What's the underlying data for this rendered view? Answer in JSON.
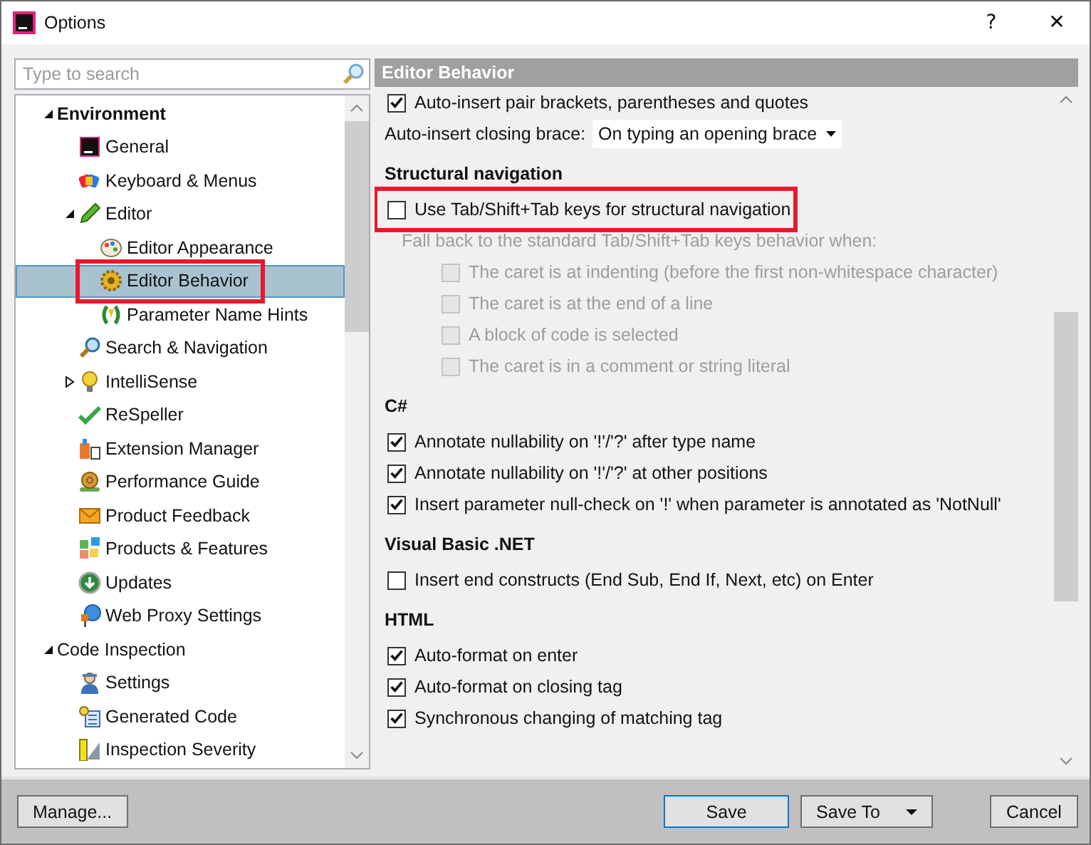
{
  "window": {
    "title": "Options",
    "help": "?",
    "close": "✕"
  },
  "search": {
    "placeholder": "Type to search"
  },
  "tree": [
    {
      "label": "Environment",
      "expanded": true,
      "selected": false,
      "highlighted": false,
      "children": [
        {
          "label": "General",
          "selected": false,
          "highlighted": false
        },
        {
          "label": "Keyboard & Menus",
          "selected": false,
          "highlighted": false
        },
        {
          "label": "Editor",
          "expanded": true,
          "selected": false,
          "highlighted": false,
          "children": [
            {
              "label": "Editor Appearance",
              "selected": false,
              "highlighted": false
            },
            {
              "label": "Editor Behavior",
              "selected": true,
              "highlighted": true
            },
            {
              "label": "Parameter Name Hints",
              "selected": false,
              "highlighted": false
            }
          ]
        },
        {
          "label": "Search & Navigation",
          "selected": false,
          "highlighted": false
        },
        {
          "label": "IntelliSense",
          "expanded": false,
          "selected": false,
          "highlighted": false
        },
        {
          "label": "ReSpeller",
          "selected": false,
          "highlighted": false
        },
        {
          "label": "Extension Manager",
          "selected": false,
          "highlighted": false
        },
        {
          "label": "Performance Guide",
          "selected": false,
          "highlighted": false
        },
        {
          "label": "Product Feedback",
          "selected": false,
          "highlighted": false
        },
        {
          "label": "Products & Features",
          "selected": false,
          "highlighted": false
        },
        {
          "label": "Updates",
          "selected": false,
          "highlighted": false
        },
        {
          "label": "Web Proxy Settings",
          "selected": false,
          "highlighted": false
        }
      ]
    },
    {
      "label": "Code Inspection",
      "expanded": true,
      "selected": false,
      "highlighted": false,
      "children": [
        {
          "label": "Settings",
          "selected": false,
          "highlighted": false
        },
        {
          "label": "Generated Code",
          "selected": false,
          "highlighted": false
        },
        {
          "label": "Inspection Severity",
          "selected": false,
          "highlighted": false
        }
      ]
    }
  ],
  "page": {
    "title": "Editor Behavior",
    "rows": [
      {
        "kind": "checkbox",
        "label": "Auto-insert pair brackets, parentheses and quotes",
        "checked": true,
        "disabled": false,
        "highlighted": false
      },
      {
        "kind": "dropdown",
        "label": "Auto-insert closing brace:",
        "value": "On typing an opening brace"
      },
      {
        "kind": "heading",
        "label": "Structural navigation"
      },
      {
        "kind": "checkbox",
        "label": "Use Tab/Shift+Tab keys for structural navigation",
        "checked": false,
        "disabled": false,
        "highlighted": true
      },
      {
        "kind": "note",
        "label": "Fall back to the standard Tab/Shift+Tab keys behavior when:",
        "disabled": true,
        "children": [
          {
            "kind": "checkbox",
            "label": "The caret is at indenting (before the first non-whitespace character)",
            "checked": false,
            "disabled": true,
            "highlighted": false
          },
          {
            "kind": "checkbox",
            "label": "The caret is at the end of a line",
            "checked": false,
            "disabled": true,
            "highlighted": false
          },
          {
            "kind": "checkbox",
            "label": "A block of code is selected",
            "checked": false,
            "disabled": true,
            "highlighted": false
          },
          {
            "kind": "checkbox",
            "label": "The caret is in a comment or string literal",
            "checked": false,
            "disabled": true,
            "highlighted": false
          }
        ]
      },
      {
        "kind": "heading",
        "label": "C#"
      },
      {
        "kind": "checkbox",
        "label": "Annotate nullability on '!'/'?' after type name",
        "checked": true,
        "disabled": false,
        "highlighted": false
      },
      {
        "kind": "checkbox",
        "label": "Annotate nullability on '!'/'?' at other positions",
        "checked": true,
        "disabled": false,
        "highlighted": false
      },
      {
        "kind": "checkbox",
        "label": "Insert parameter null-check on '!' when parameter is annotated as 'NotNull'",
        "checked": true,
        "disabled": false,
        "highlighted": false
      },
      {
        "kind": "heading",
        "label": "Visual Basic .NET"
      },
      {
        "kind": "checkbox",
        "label": "Insert end constructs (End Sub, End If, Next, etc) on Enter",
        "checked": false,
        "disabled": false,
        "highlighted": false
      },
      {
        "kind": "heading",
        "label": "HTML"
      },
      {
        "kind": "checkbox",
        "label": "Auto-format on enter",
        "checked": true,
        "disabled": false,
        "highlighted": false
      },
      {
        "kind": "checkbox",
        "label": "Auto-format on closing tag",
        "checked": true,
        "disabled": false,
        "highlighted": false
      },
      {
        "kind": "checkbox",
        "label": "Synchronous changing of matching tag",
        "checked": true,
        "disabled": false,
        "highlighted": false
      }
    ]
  },
  "buttons": [
    {
      "label": "Manage...",
      "kind": "plain"
    },
    {
      "label": "Save",
      "kind": "default"
    },
    {
      "label": "Save To",
      "kind": "split"
    },
    {
      "label": "Cancel",
      "kind": "plain"
    }
  ]
}
